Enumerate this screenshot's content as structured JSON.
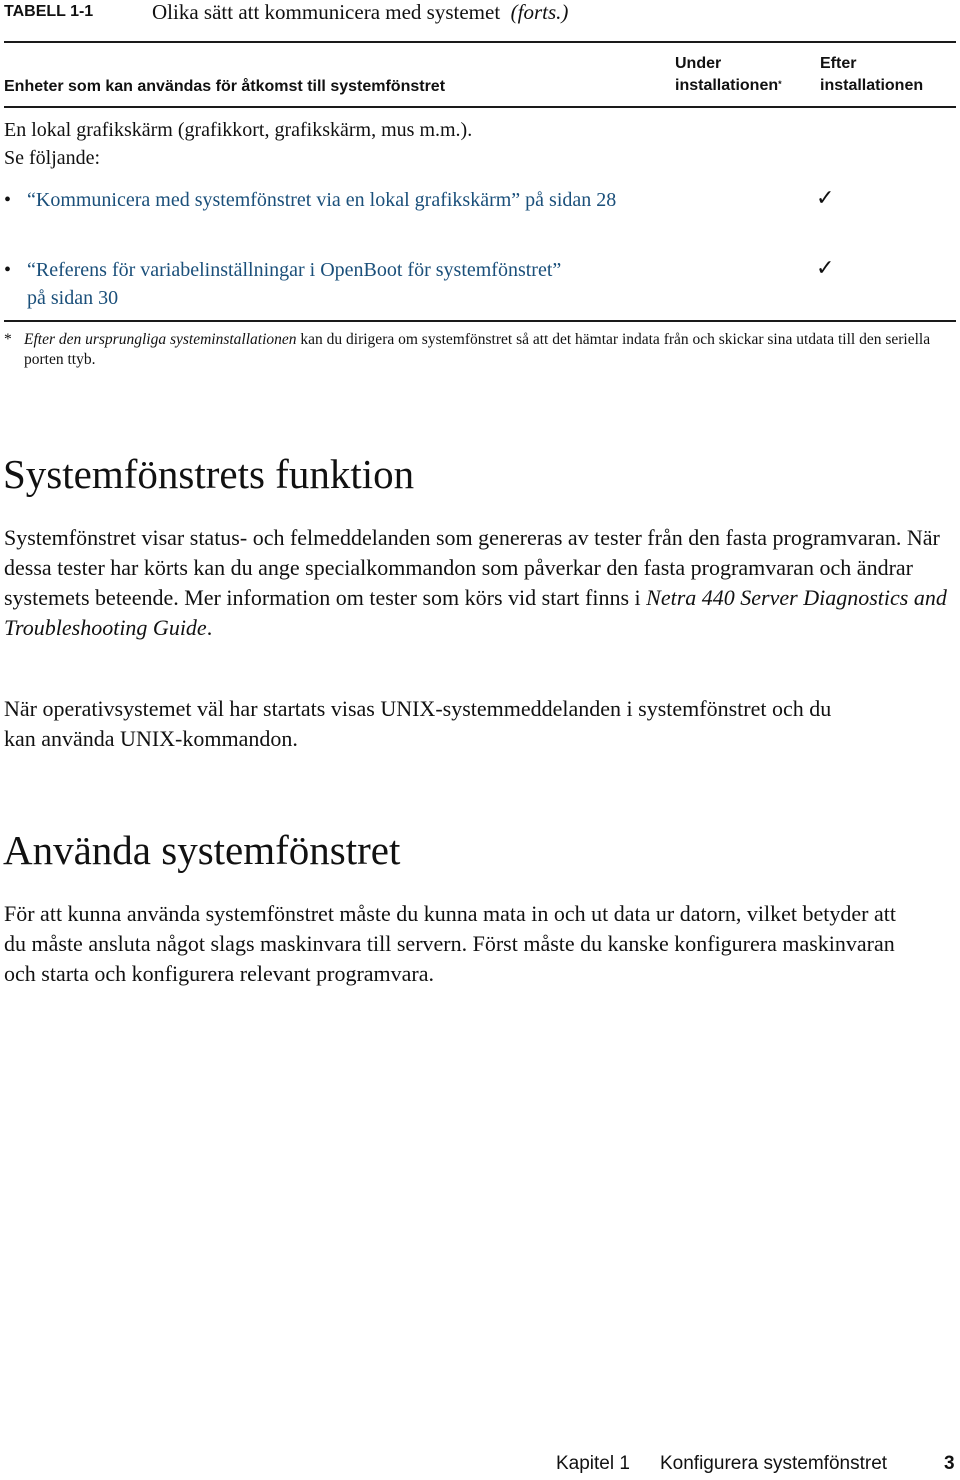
{
  "table": {
    "caption_label": "TABELL 1-1",
    "caption_title": "Olika sätt att kommunicera med systemet",
    "caption_cont": "(forts.)",
    "headers": {
      "devices": "Enheter som kan användas för åtkomst till systemfönstret",
      "during_line1": "Under",
      "during_line2": "installationen",
      "during_marker": "*",
      "after_line1": "Efter",
      "after_line2": "installationen"
    },
    "row": {
      "description_line1": "En lokal grafikskärm (grafikkort, grafikskärm, mus m.m.).",
      "description_line2": "Se följande:",
      "links": [
        {
          "bullet": "•",
          "text": "“Kommunicera med systemfönstret via en lokal grafikskärm” på sidan 28",
          "during": "",
          "after": "✓"
        },
        {
          "bullet": "•",
          "text": "“Referens för variabelinställningar i OpenBoot för systemfönstret” på sidan 30",
          "during": "",
          "after": "✓"
        }
      ]
    },
    "footnote": {
      "marker": "*",
      "italic": "Efter den ursprungliga systeminstallationen",
      "text": " kan du dirigera om systemfönstret så att det hämtar indata från och skickar sina utdata till den seriella porten ttyb."
    }
  },
  "sections": [
    {
      "heading": "Systemfönstrets funktion",
      "paragraphs": [
        {
          "before": "Systemfönstret visar status- och felmeddelanden som genereras av tester från den fasta programvaran. När dessa tester har körts kan du ange specialkommandon som påverkar den fasta programvaran och ändrar systemets beteende. Mer information om tester som körs vid start finns i ",
          "italic": "Netra 440 Server Diagnostics and Troubleshooting Guide",
          "after": "."
        },
        {
          "text": "När operativsystemet väl har startats visas UNIX-systemmeddelanden i systemfönstret och du kan använda UNIX-kommandon."
        }
      ]
    },
    {
      "heading": "Använda systemfönstret",
      "paragraphs": [
        {
          "text": "För att kunna använda systemfönstret måste du kunna mata in och ut data ur datorn, vilket betyder att du måste ansluta något slags maskinvara till servern. Först måste du kanske konfigurera maskinvaran och starta och konfigurera relevant programvara."
        }
      ]
    }
  ],
  "footer": {
    "chapter": "Kapitel 1",
    "title": "Konfigurera systemfönstret",
    "page": "3"
  },
  "colors": {
    "link": "#1a4f7a",
    "text": "#111111",
    "rule": "#1a1a1a"
  }
}
